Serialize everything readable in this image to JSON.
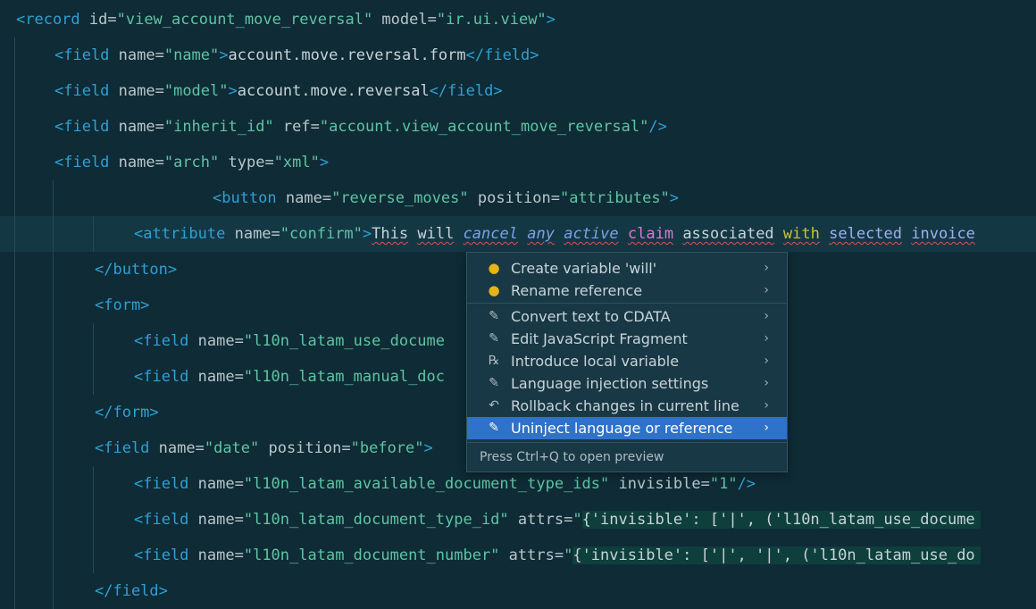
{
  "code_lines": [
    {
      "segments": [
        {
          "cls": "t",
          "text": "<record"
        },
        {
          "cls": "a",
          "text": " id="
        },
        {
          "cls": "v",
          "text": "\"view_account_move_reversal\""
        },
        {
          "cls": "a",
          "text": " model="
        },
        {
          "cls": "v",
          "text": "\"ir.ui.view\""
        },
        {
          "cls": "t",
          "text": ">"
        }
      ]
    },
    {
      "segments": [
        {
          "cls": "t",
          "text": "<field"
        },
        {
          "cls": "a",
          "text": " name="
        },
        {
          "cls": "v",
          "text": "\"name\""
        },
        {
          "cls": "t",
          "text": ">"
        },
        {
          "cls": "x",
          "text": "account.move.reversal.form"
        },
        {
          "cls": "t",
          "text": "</field>"
        }
      ]
    },
    {
      "segments": [
        {
          "cls": "t",
          "text": "<field"
        },
        {
          "cls": "a",
          "text": " name="
        },
        {
          "cls": "v",
          "text": "\"model\""
        },
        {
          "cls": "t",
          "text": ">"
        },
        {
          "cls": "x",
          "text": "account.move.reversal"
        },
        {
          "cls": "t",
          "text": "</field>"
        }
      ]
    },
    {
      "segments": [
        {
          "cls": "t",
          "text": "<field"
        },
        {
          "cls": "a",
          "text": " name="
        },
        {
          "cls": "v",
          "text": "\"inherit_id\""
        },
        {
          "cls": "a",
          "text": " ref="
        },
        {
          "cls": "v",
          "text": "\"account.view_account_move_reversal\""
        },
        {
          "cls": "t",
          "text": "/>"
        }
      ]
    },
    {
      "segments": [
        {
          "cls": "t",
          "text": "<field"
        },
        {
          "cls": "a",
          "text": " name="
        },
        {
          "cls": "v",
          "text": "\"arch\""
        },
        {
          "cls": "a",
          "text": " type="
        },
        {
          "cls": "v",
          "text": "\"xml\""
        },
        {
          "cls": "t",
          "text": ">"
        }
      ]
    },
    {
      "segments": [
        {
          "cls": "t",
          "text": "<button"
        },
        {
          "cls": "a",
          "text": " name="
        },
        {
          "cls": "v",
          "text": "\"reverse_moves\""
        },
        {
          "cls": "a",
          "text": " position="
        },
        {
          "cls": "v",
          "text": "\"attributes\""
        },
        {
          "cls": "t",
          "text": ">"
        }
      ]
    },
    {
      "segments": [
        {
          "cls": "t",
          "text": "<attribute"
        },
        {
          "cls": "a",
          "text": " name="
        },
        {
          "cls": "v",
          "text": "\"confirm\""
        },
        {
          "cls": "t",
          "text": ">"
        },
        {
          "cls": "x err",
          "text": "This"
        },
        {
          "cls": "x",
          "text": " "
        },
        {
          "cls": "x err",
          "text": "will"
        },
        {
          "cls": "x",
          "text": " "
        },
        {
          "cls": "w-cancel err",
          "text": "cancel"
        },
        {
          "cls": "x",
          "text": " "
        },
        {
          "cls": "w-any err",
          "text": "any"
        },
        {
          "cls": "x",
          "text": " "
        },
        {
          "cls": "w-active err",
          "text": "active"
        },
        {
          "cls": "x",
          "text": " "
        },
        {
          "cls": "w-claim err",
          "text": "claim"
        },
        {
          "cls": "x",
          "text": " "
        },
        {
          "cls": "x err",
          "text": "associated"
        },
        {
          "cls": "x",
          "text": " "
        },
        {
          "cls": "w-with err",
          "text": "with"
        },
        {
          "cls": "x",
          "text": " "
        },
        {
          "cls": "w-selected err",
          "text": "selected"
        },
        {
          "cls": "x",
          "text": " "
        },
        {
          "cls": "w-invoice err",
          "text": "invoice"
        }
      ]
    },
    {
      "segments": [
        {
          "cls": "t",
          "text": "</button>"
        }
      ]
    },
    {
      "segments": [
        {
          "cls": "t",
          "text": "<form>"
        }
      ]
    },
    {
      "segments": [
        {
          "cls": "t",
          "text": "<field"
        },
        {
          "cls": "a",
          "text": " name="
        },
        {
          "cls": "v",
          "text": "\"l10n_latam_use_docume"
        }
      ]
    },
    {
      "segments": [
        {
          "cls": "t",
          "text": "<field"
        },
        {
          "cls": "a",
          "text": " name="
        },
        {
          "cls": "v",
          "text": "\"l10n_latam_manual_doc"
        }
      ]
    },
    {
      "segments": [
        {
          "cls": "t",
          "text": "</form>"
        }
      ]
    },
    {
      "segments": [
        {
          "cls": "t",
          "text": "<field"
        },
        {
          "cls": "a",
          "text": " name="
        },
        {
          "cls": "v",
          "text": "\"date\""
        },
        {
          "cls": "a",
          "text": " position="
        },
        {
          "cls": "v",
          "text": "\"before\""
        },
        {
          "cls": "t",
          "text": ">"
        }
      ]
    },
    {
      "segments": [
        {
          "cls": "t",
          "text": "<field"
        },
        {
          "cls": "a",
          "text": " name="
        },
        {
          "cls": "v",
          "text": "\"l10n_latam_available_document_type_ids\""
        },
        {
          "cls": "a",
          "text": " invisible="
        },
        {
          "cls": "v",
          "text": "\"1\""
        },
        {
          "cls": "t",
          "text": "/>"
        }
      ]
    },
    {
      "segments": [
        {
          "cls": "t",
          "text": "<field"
        },
        {
          "cls": "a",
          "text": " name="
        },
        {
          "cls": "v",
          "text": "\"l10n_latam_document_type_id\""
        },
        {
          "cls": "a",
          "text": " attrs="
        },
        {
          "cls": "v",
          "text": "\""
        },
        {
          "cls": "x injected",
          "text": "{'invisible': ['|', ('l10n_latam_use_docume"
        }
      ]
    },
    {
      "segments": [
        {
          "cls": "t",
          "text": "<field"
        },
        {
          "cls": "a",
          "text": " name="
        },
        {
          "cls": "v",
          "text": "\"l10n_latam_document_number\""
        },
        {
          "cls": "a",
          "text": " attrs="
        },
        {
          "cls": "v",
          "text": "\""
        },
        {
          "cls": "x injected",
          "text": "{'invisible': ['|', '|', ('l10n_latam_use_do"
        }
      ]
    },
    {
      "segments": [
        {
          "cls": "t",
          "text": "</field>"
        }
      ]
    }
  ],
  "context_menu": {
    "items": [
      {
        "name": "menu-create-variable",
        "icon": "bulb-icon",
        "glyph": "●",
        "label": "Create variable 'will'"
      },
      {
        "name": "menu-rename-reference",
        "icon": "bulb-icon",
        "glyph": "●",
        "label": "Rename reference"
      },
      {
        "name": "menu-convert-cdata",
        "icon": "edit-icon",
        "glyph": "✎",
        "label": "Convert text to CDATA"
      },
      {
        "name": "menu-edit-js-fragment",
        "icon": "edit-icon",
        "glyph": "✎",
        "label": "Edit JavaScript Fragment"
      },
      {
        "name": "menu-introduce-local-variable",
        "icon": "refactor-icon",
        "glyph": "℞",
        "label": "Introduce local variable"
      },
      {
        "name": "menu-language-injection-settings",
        "icon": "edit-icon",
        "glyph": "✎",
        "label": "Language injection settings"
      },
      {
        "name": "menu-rollback-changes",
        "icon": "undo-icon",
        "glyph": "↶",
        "label": "Rollback changes in current line"
      },
      {
        "name": "menu-uninject-language",
        "icon": "edit-icon",
        "glyph": "✎",
        "label": "Uninject language or reference",
        "selected": true
      }
    ],
    "hint": "Press Ctrl+Q to open preview",
    "chevron": "›"
  },
  "colors": {
    "background": "#0f2b35",
    "current_line": "#143744",
    "selection": "#2e72c9",
    "tag": "#2fa0d5",
    "string": "#5ec4a4"
  }
}
